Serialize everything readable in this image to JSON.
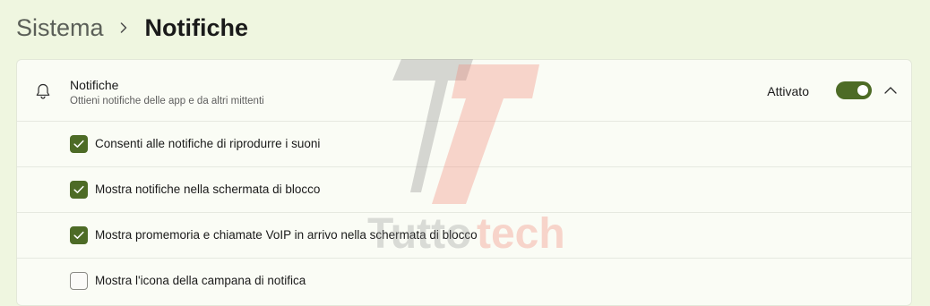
{
  "breadcrumb": {
    "parent": "Sistema",
    "current": "Notifiche"
  },
  "notifications": {
    "title": "Notifiche",
    "subtitle": "Ottieni notifiche delle app e da altri mittenti",
    "status": "Attivato",
    "enabled": true,
    "icon": "bell-icon",
    "options": [
      {
        "label": "Consenti alle notifiche di riprodurre i suoni",
        "checked": true
      },
      {
        "label": "Mostra notifiche nella schermata di blocco",
        "checked": true
      },
      {
        "label": "Mostra promemoria e chiamate VoIP in arrivo nella schermata di blocco",
        "checked": true
      },
      {
        "label": "Mostra l'icona della campana di notifica",
        "checked": false
      }
    ]
  },
  "watermark": {
    "text_part1": "Tutto",
    "text_part2": "tech"
  },
  "colors": {
    "accent": "#4d6b26",
    "background": "#eff6e0",
    "card": "#fafcf5"
  }
}
